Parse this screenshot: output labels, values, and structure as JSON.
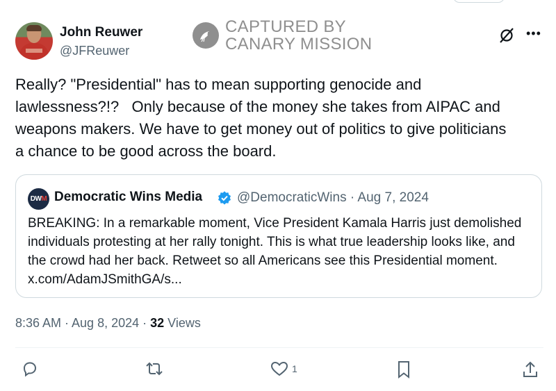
{
  "author": {
    "name": "John Reuwer",
    "handle": "@JFReuwer"
  },
  "watermark": {
    "line1": "CAPTURED BY",
    "line2": "CANARY MISSION"
  },
  "tweet": {
    "text": "Really? \"Presidential\" has to mean supporting genocide and\nlawlessness?!?   Only because of the money she takes from AIPAC and\nweapons makers. We have to get money out of politics to give politicians\na chance to be good across the board."
  },
  "quote": {
    "avatar_text_a": "DW",
    "avatar_text_b": "M",
    "name": "Democratic Wins Media",
    "handle_date": "@DemocraticWins · Aug 7, 2024",
    "text": "BREAKING: In a remarkable moment, Vice President Kamala Harris just demolished individuals protesting at her rally tonight. This is what true leadership looks like, and the crowd had her back. Retweet so all Americans see this Presidential moment. x.com/AdamJSmithGA/s..."
  },
  "meta": {
    "timestamp": "8:36 AM · Aug 8, 2024 · ",
    "views_count": "32",
    "views_label": " Views"
  },
  "actions": {
    "like_count": "1"
  },
  "icons": [
    "grok-icon",
    "more-icon",
    "verified-badge-icon",
    "reply-icon",
    "retweet-icon",
    "like-icon",
    "bookmark-icon",
    "share-icon"
  ],
  "colors": {
    "verified": "#1d9bf0",
    "muted": "#536471",
    "watermark": "#8f8f8f"
  }
}
